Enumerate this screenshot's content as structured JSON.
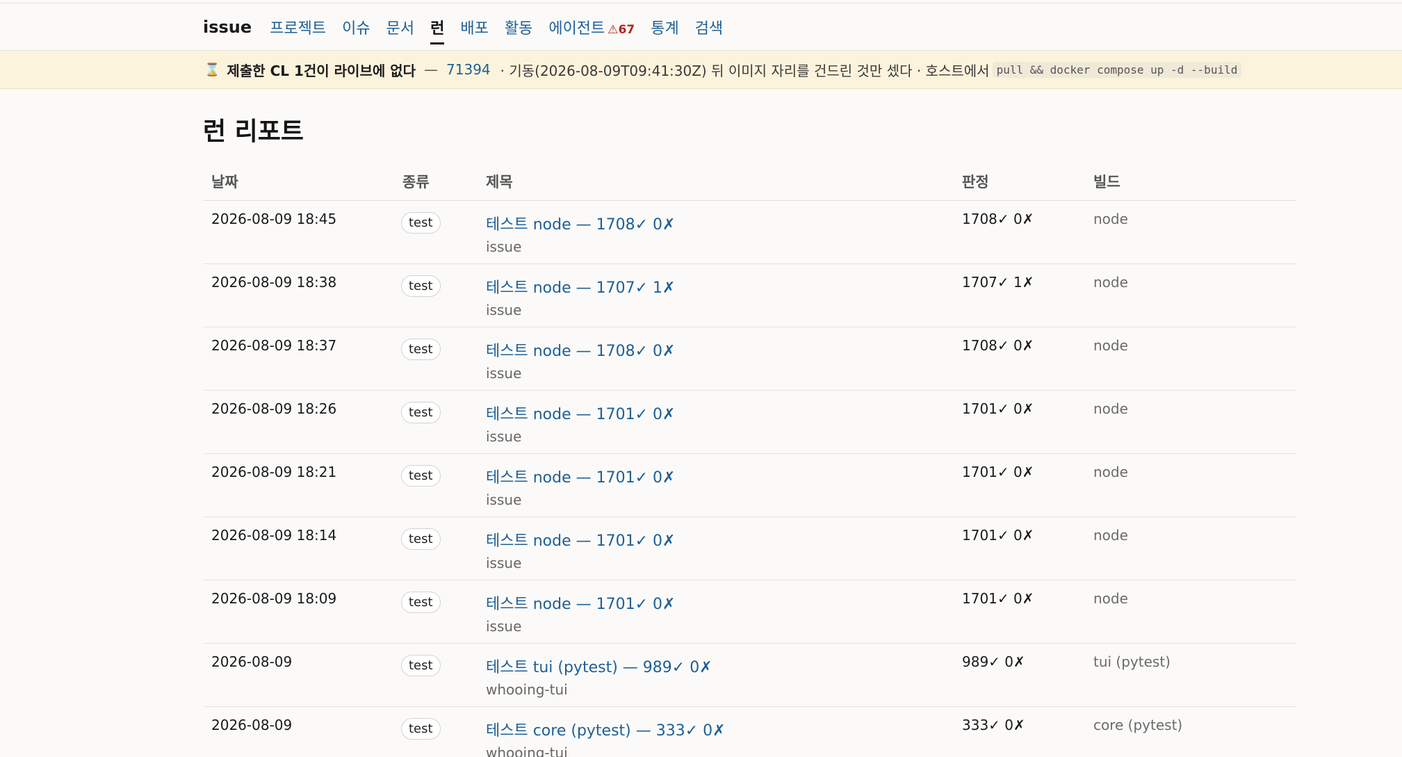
{
  "nav": {
    "brand": "issue",
    "items": [
      {
        "label": "프로젝트",
        "active": false
      },
      {
        "label": "이슈",
        "active": false
      },
      {
        "label": "문서",
        "active": false
      },
      {
        "label": "런",
        "active": true
      },
      {
        "label": "배포",
        "active": false
      },
      {
        "label": "활동",
        "active": false
      },
      {
        "label": "에이전트",
        "active": false,
        "badge": "⚠67"
      },
      {
        "label": "통계",
        "active": false
      },
      {
        "label": "검색",
        "active": false
      }
    ]
  },
  "banner": {
    "icon": "⌛",
    "headline": "제출한 CL 1건이 라이브에 없다",
    "dash": "—",
    "cl_link": "71394",
    "detail": "· 기동(2026-08-09T09:41:30Z) 뒤 이미지 자리를 건드린 것만 셌다 · 호스트에서",
    "command": "pull && docker compose up -d --build"
  },
  "page": {
    "title": "런 리포트"
  },
  "table": {
    "headers": {
      "date": "날짜",
      "kind": "종류",
      "title": "제목",
      "verdict": "판정",
      "build": "빌드"
    },
    "rows": [
      {
        "date": "2026-08-09 18:45",
        "kind": "test",
        "title": "테스트 node — 1708✓ 0✗",
        "project": "issue",
        "verdict": "1708✓ 0✗",
        "build": "node"
      },
      {
        "date": "2026-08-09 18:38",
        "kind": "test",
        "title": "테스트 node — 1707✓ 1✗",
        "project": "issue",
        "verdict": "1707✓ 1✗",
        "build": "node"
      },
      {
        "date": "2026-08-09 18:37",
        "kind": "test",
        "title": "테스트 node — 1708✓ 0✗",
        "project": "issue",
        "verdict": "1708✓ 0✗",
        "build": "node"
      },
      {
        "date": "2026-08-09 18:26",
        "kind": "test",
        "title": "테스트 node — 1701✓ 0✗",
        "project": "issue",
        "verdict": "1701✓ 0✗",
        "build": "node"
      },
      {
        "date": "2026-08-09 18:21",
        "kind": "test",
        "title": "테스트 node — 1701✓ 0✗",
        "project": "issue",
        "verdict": "1701✓ 0✗",
        "build": "node"
      },
      {
        "date": "2026-08-09 18:14",
        "kind": "test",
        "title": "테스트 node — 1701✓ 0✗",
        "project": "issue",
        "verdict": "1701✓ 0✗",
        "build": "node"
      },
      {
        "date": "2026-08-09 18:09",
        "kind": "test",
        "title": "테스트 node — 1701✓ 0✗",
        "project": "issue",
        "verdict": "1701✓ 0✗",
        "build": "node"
      },
      {
        "date": "2026-08-09",
        "kind": "test",
        "title": "테스트 tui (pytest) — 989✓ 0✗",
        "project": "whooing-tui",
        "verdict": "989✓ 0✗",
        "build": "tui (pytest)"
      },
      {
        "date": "2026-08-09",
        "kind": "test",
        "title": "테스트 core (pytest) — 333✓ 0✗",
        "project": "whooing-tui",
        "verdict": "333✓ 0✗",
        "build": "core (pytest)"
      }
    ]
  }
}
